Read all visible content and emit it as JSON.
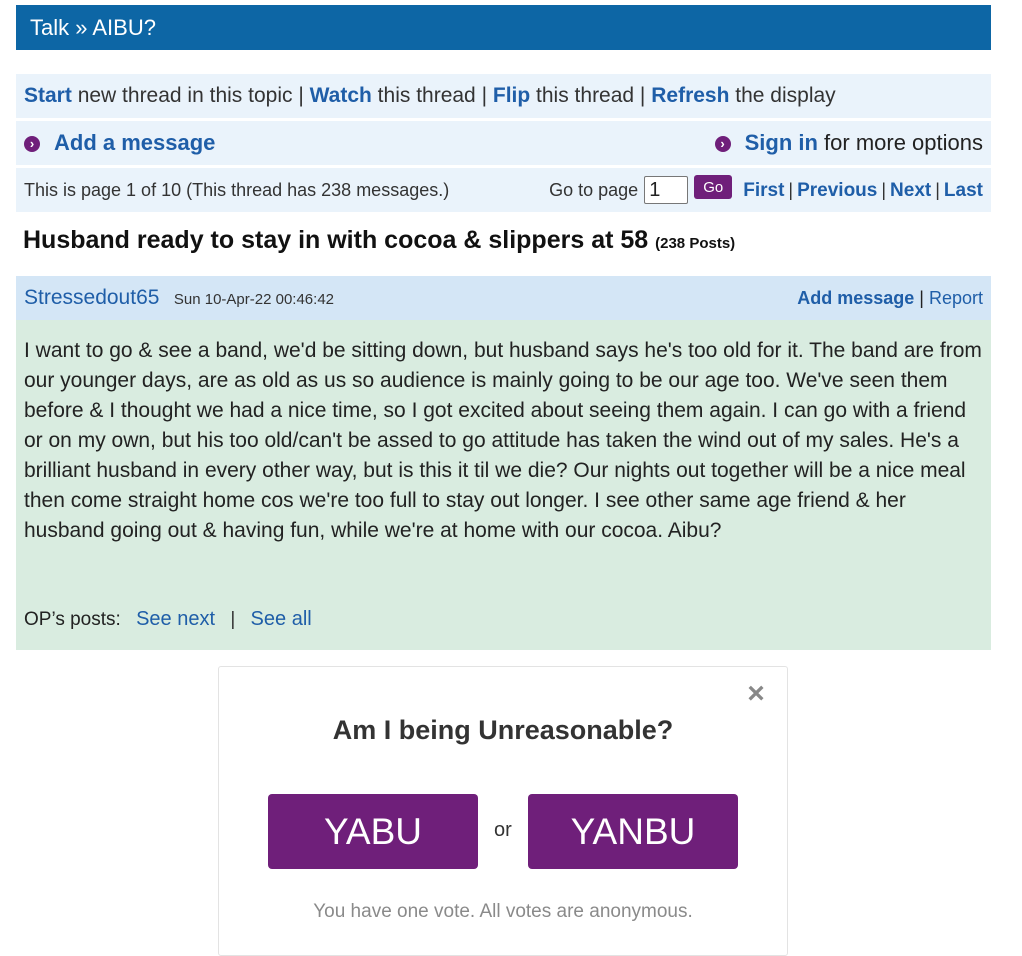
{
  "breadcrumb": {
    "text": "Talk » AIBU?"
  },
  "actions": {
    "start": "Start",
    "start_rest": " new thread in this topic | ",
    "watch": "Watch",
    "watch_rest": " this thread | ",
    "flip": "Flip",
    "flip_rest": " this thread | ",
    "refresh": "Refresh",
    "refresh_rest": " the display"
  },
  "compose": {
    "add_message": "Add a message",
    "sign_in": "Sign in",
    "sign_in_rest": " for more options"
  },
  "paging": {
    "info": "This is page 1 of 10 (This thread has 238 messages.)",
    "goto_label": "Go to page",
    "page_value": "1",
    "go": "Go",
    "first": "First",
    "previous": "Previous",
    "next": "Next",
    "last": "Last",
    "sep": "|"
  },
  "thread": {
    "title": "Husband ready to stay in with cocoa & slippers at 58",
    "post_count": "(238 Posts)"
  },
  "post": {
    "author": "Stressedout65",
    "date": "Sun 10-Apr-22 00:46:42",
    "add_message": "Add message",
    "report_sep": " | ",
    "report": "Report",
    "body": "I want to go & see a band, we'd be sitting down, but husband says he's too old for it. The band are from our younger days, are as old as us so audience is mainly going to be our age too. We've seen them before & I thought we had a nice time, so I got excited about seeing them again. I can go with a friend or on my own, but his too old/can't be assed to go attitude has taken the wind out of my sales. He's a brilliant husband in every other way, but is this it til we die? Our nights out together will be a nice meal then come straight home cos we're too full to stay out longer. I see other same age friend & her husband going out & having fun, while we're at home with our cocoa. Aibu?",
    "op_posts_label": "OP’s posts:",
    "see_next": "See next",
    "see_all": "See all",
    "op_sep": "|"
  },
  "poll": {
    "close_icon": "×",
    "question": "Am I being Unreasonable?",
    "option_yes": "YABU",
    "or": "or",
    "option_no": "YANBU",
    "note": "You have one vote. All votes are anonymous."
  },
  "colors": {
    "header_blue": "#0d66a5",
    "accent_purple": "#6f1f7a",
    "link_blue": "#1f5ea8",
    "post_green": "#d9ece0"
  }
}
